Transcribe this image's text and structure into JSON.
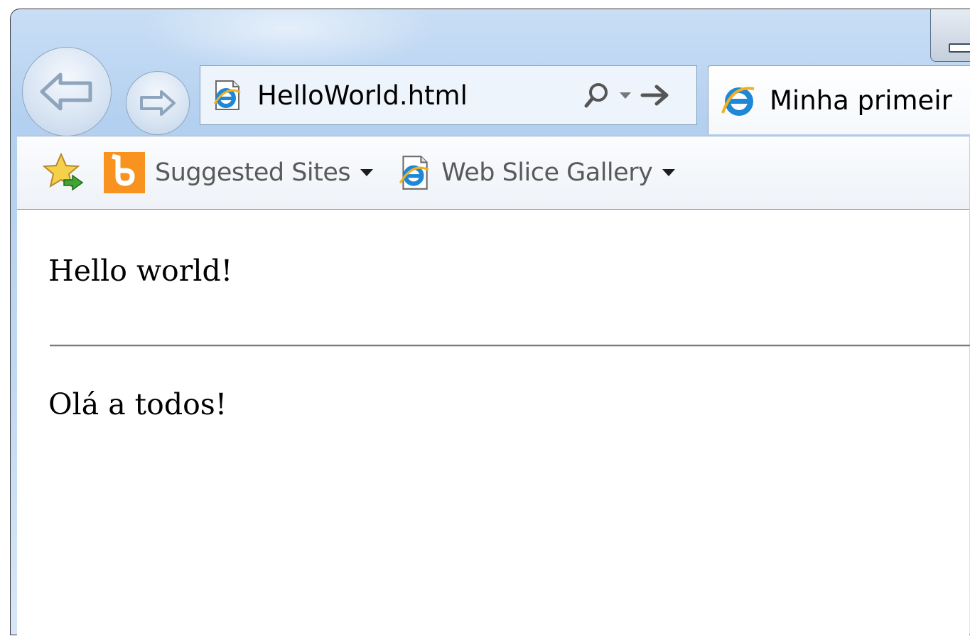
{
  "address_bar": {
    "url": "HelloWorld.html",
    "favicon": "ie-page-icon",
    "search_icon": "search-icon",
    "go_icon": "go-arrow-icon"
  },
  "tab": {
    "title": "Minha primeir",
    "favicon": "ie-logo-icon"
  },
  "favorites_bar": {
    "items": [
      {
        "label": "Suggested Sites",
        "icon": "bing-icon"
      },
      {
        "label": "Web Slice Gallery",
        "icon": "ie-page-icon"
      }
    ]
  },
  "page": {
    "paragraph_1": "Hello world!",
    "paragraph_2": "Olá a todos!"
  },
  "colors": {
    "chrome_blue": "#b3d0f0",
    "ie_blue": "#1e88d6",
    "ie_gold": "#f2b01e",
    "bing_orange": "#f7931e",
    "star_yellow": "#f5d04a",
    "arrow_green": "#3ea535"
  }
}
